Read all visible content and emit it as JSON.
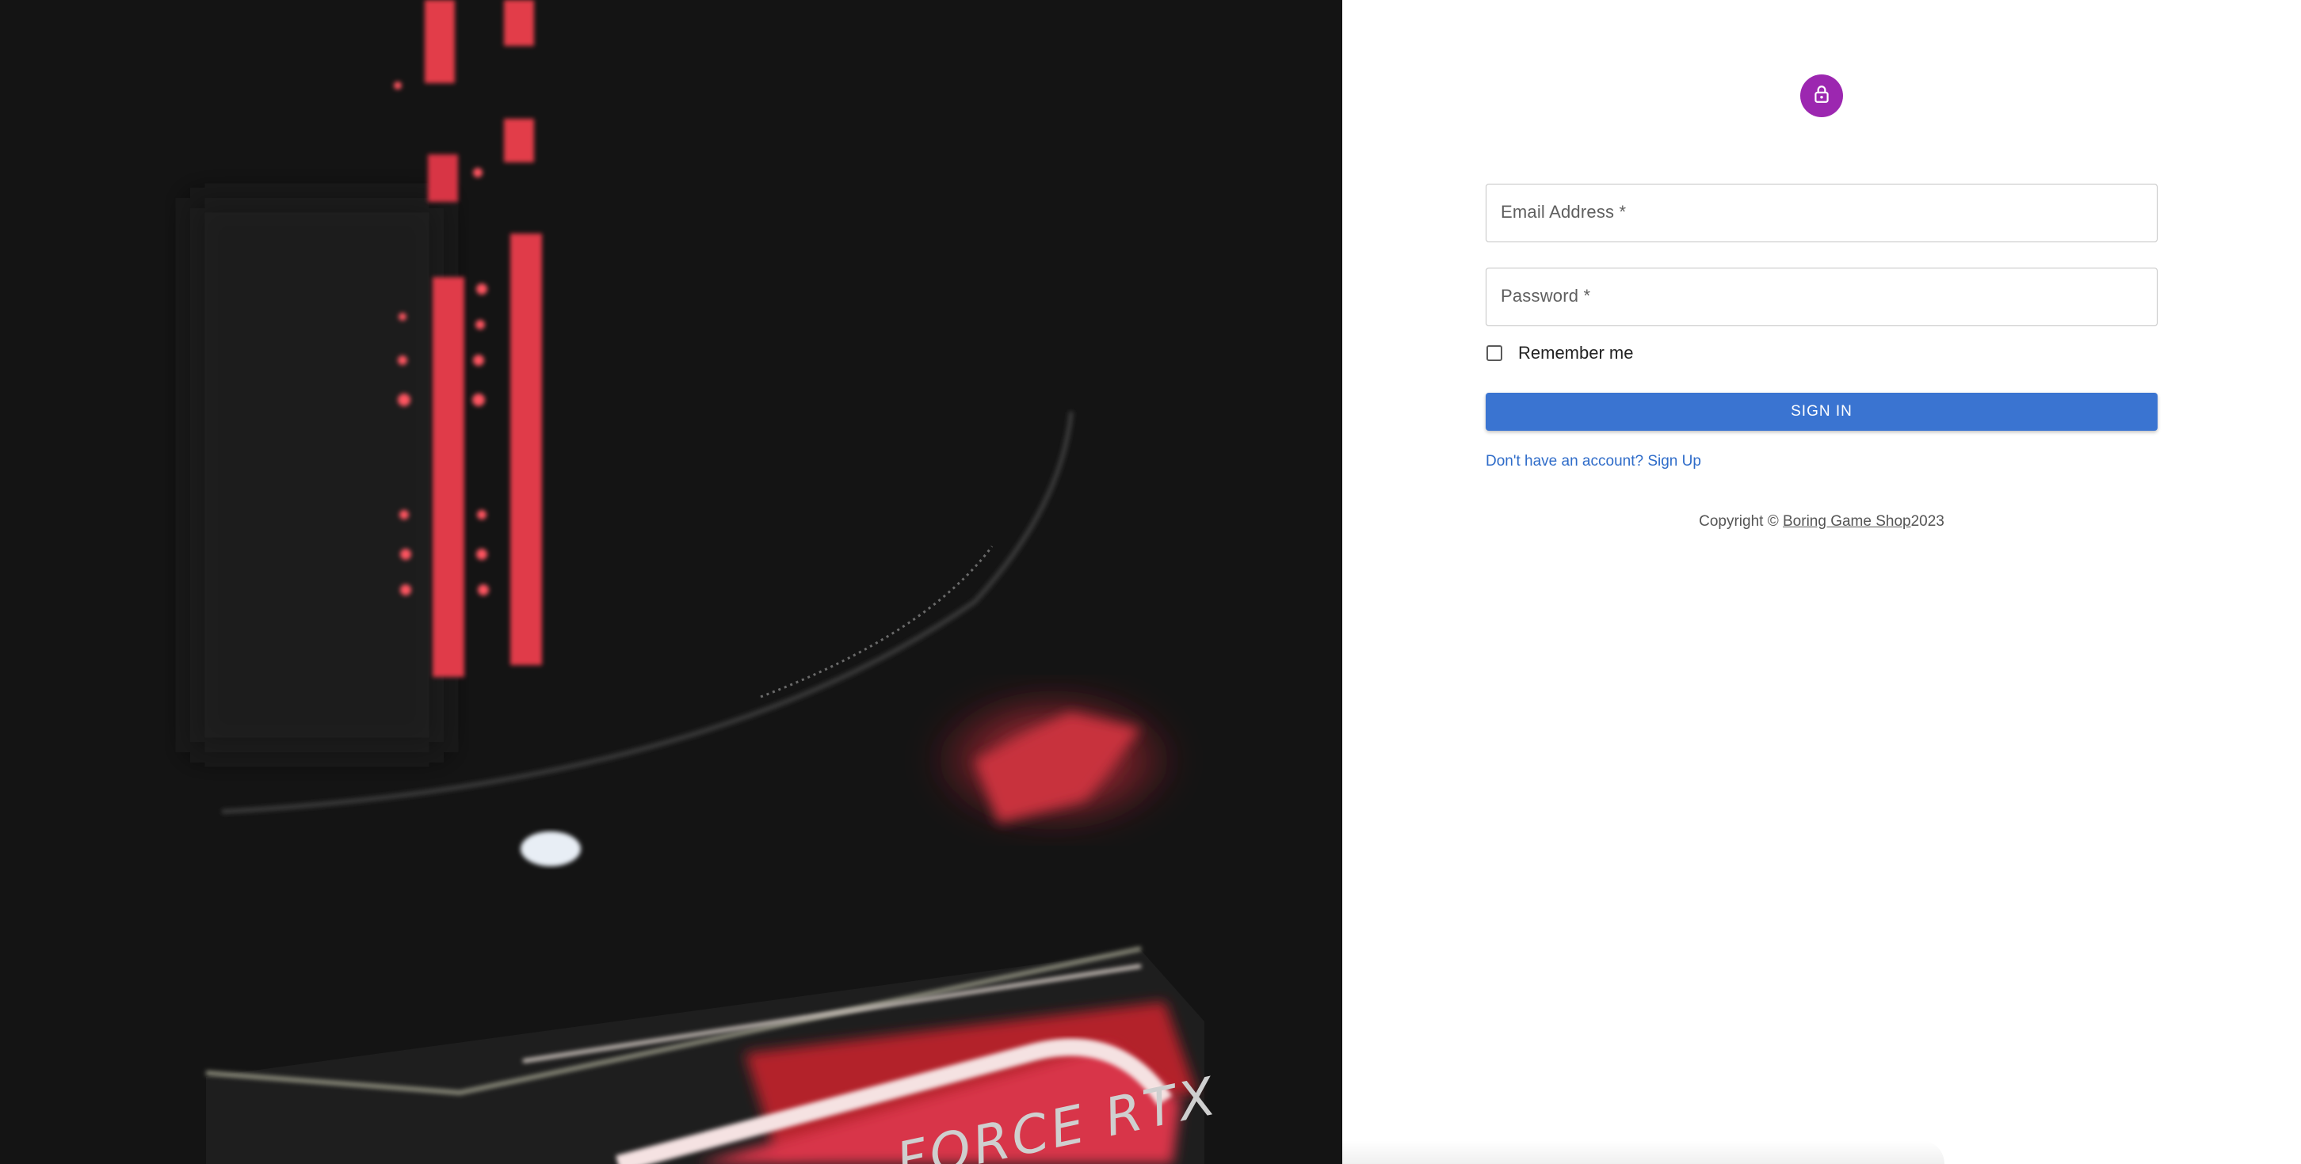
{
  "hero": {
    "image_description_icon": "gpu-photo",
    "card_text": "FORCE RTX"
  },
  "form": {
    "avatar_icon": "lock-icon",
    "email": {
      "label": "Email Address *",
      "value": ""
    },
    "password": {
      "label": "Password *",
      "value": ""
    },
    "remember_label": "Remember me",
    "remember_checked": false,
    "signin_label": "SIGN IN",
    "signup_link": "Don't have an account? Sign Up"
  },
  "footer": {
    "copyright_prefix": "Copyright © ",
    "brand": "Boring Game Shop",
    "year": "2023"
  },
  "colors": {
    "accent": "#3a74d1",
    "avatar": "#9c27b0",
    "link": "#2f6cc9"
  }
}
